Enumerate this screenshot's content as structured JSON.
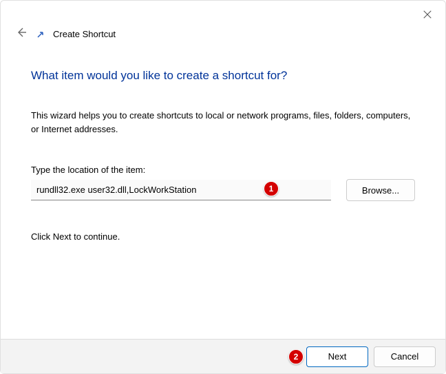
{
  "window": {
    "close_tooltip": "Close"
  },
  "header": {
    "title": "Create Shortcut"
  },
  "main": {
    "question": "What item would you like to create a shortcut for?",
    "description": "This wizard helps you to create shortcuts to local or network programs, files, folders, computers, or Internet addresses.",
    "location_label": "Type the location of the item:",
    "location_value": "rundll32.exe user32.dll,LockWorkStation",
    "browse_label": "Browse...",
    "continue_hint": "Click Next to continue."
  },
  "footer": {
    "next_label": "Next",
    "cancel_label": "Cancel"
  },
  "annotations": {
    "badge1": "1",
    "badge2": "2"
  }
}
